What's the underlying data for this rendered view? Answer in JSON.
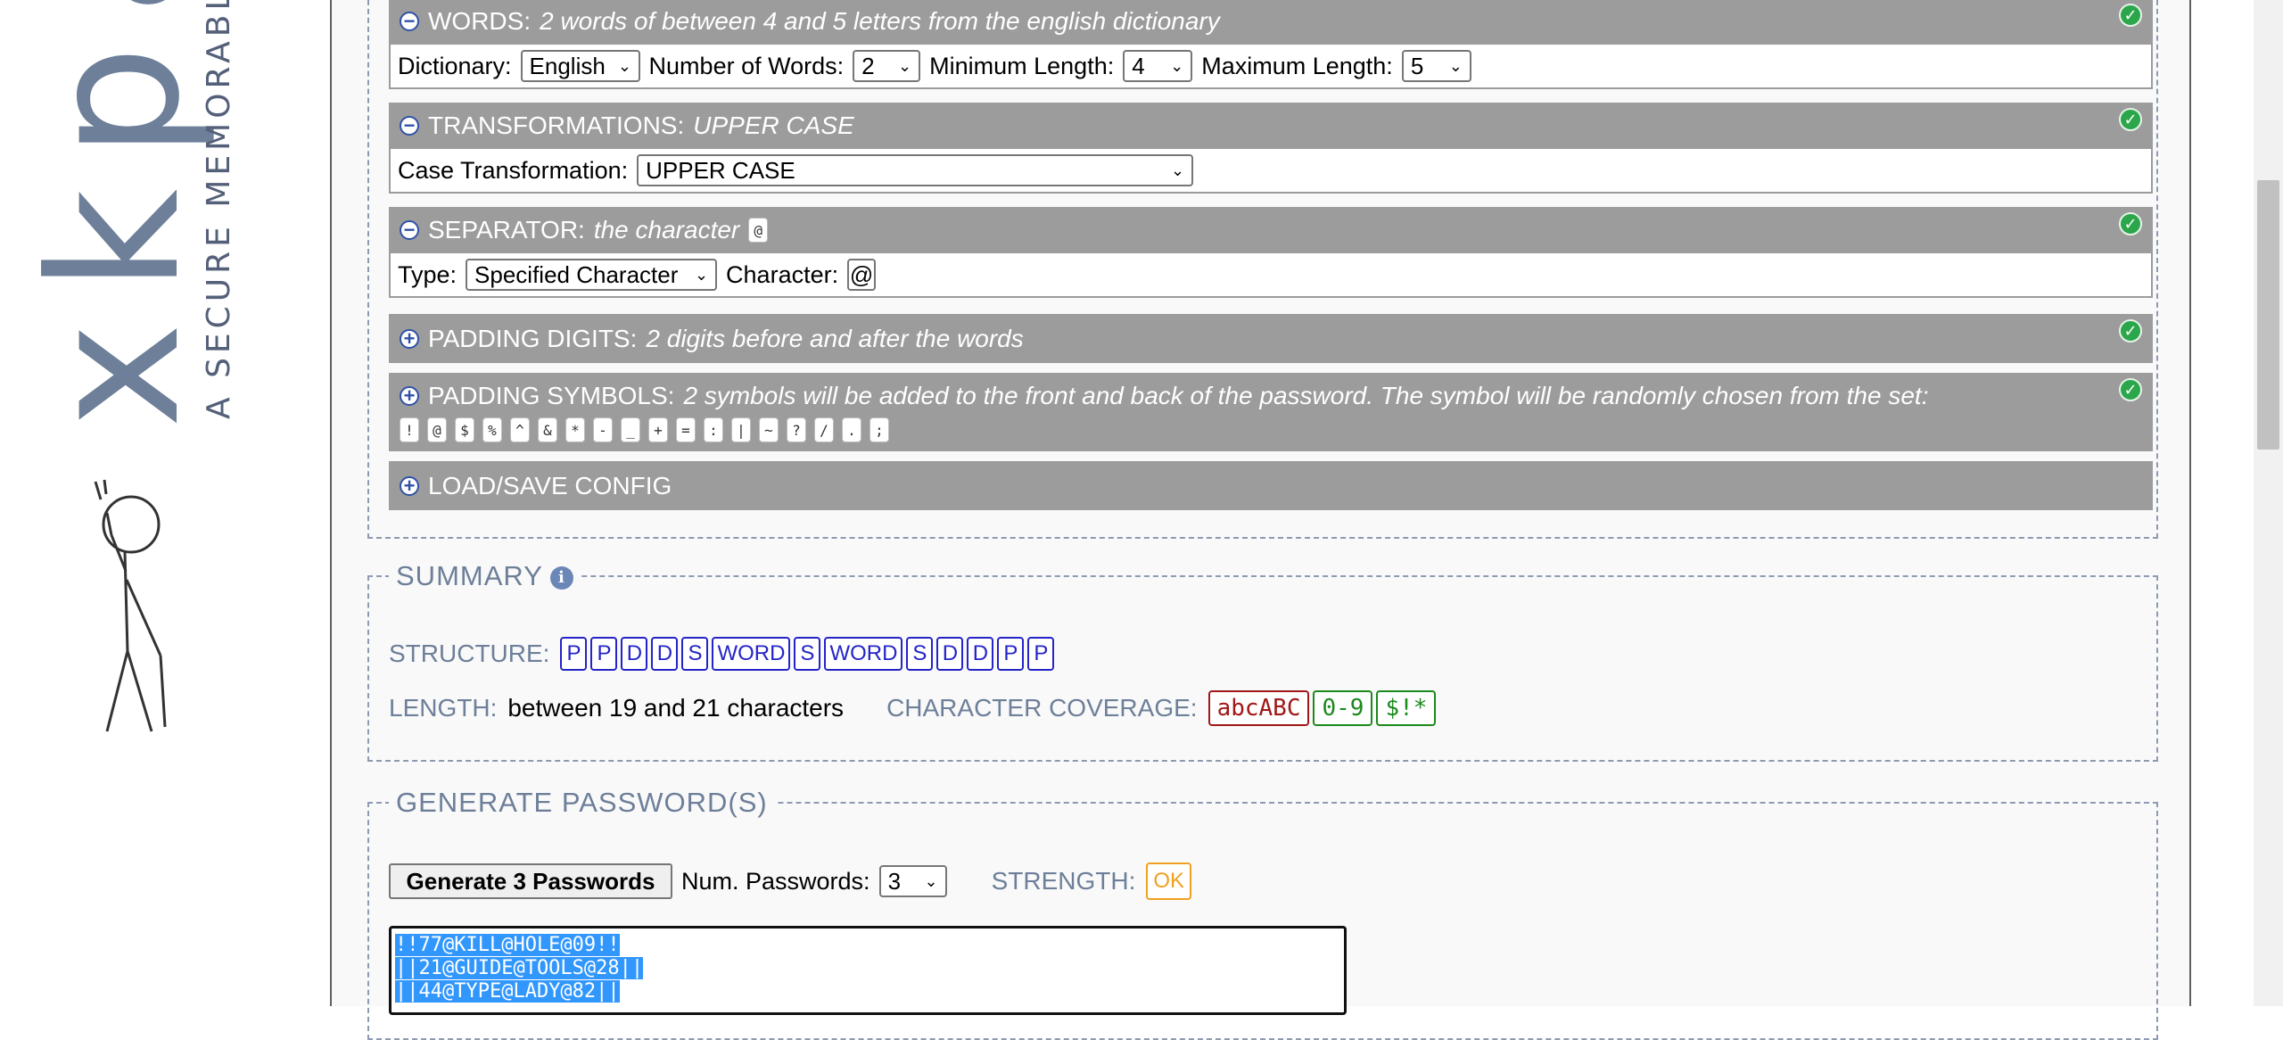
{
  "brand": {
    "logo_text": "xkpa",
    "tagline": "A SECURE MEMORABL"
  },
  "sections": {
    "words": {
      "title": "WORDS:",
      "summary": "2 words of between 4 and 5 letters from the english dictionary",
      "dictionary_label": "Dictionary:",
      "dictionary_value": "English",
      "num_words_label": "Number of Words:",
      "num_words_value": "2",
      "min_len_label": "Minimum Length:",
      "min_len_value": "4",
      "max_len_label": "Maximum Length:",
      "max_len_value": "5"
    },
    "transformations": {
      "title": "TRANSFORMATIONS:",
      "summary": "UPPER CASE",
      "case_label": "Case Transformation:",
      "case_value": "UPPER CASE"
    },
    "separator": {
      "title": "SEPARATOR:",
      "summary": "the character",
      "summary_char": "@",
      "type_label": "Type:",
      "type_value": "Specified Character",
      "char_label": "Character:",
      "char_value": "@"
    },
    "padding_digits": {
      "title": "PADDING DIGITS:",
      "summary": "2 digits before and after the words"
    },
    "padding_symbols": {
      "title": "PADDING SYMBOLS:",
      "summary": "2 symbols will be added to the front and back of the password. The symbol will be randomly chosen from the set:",
      "symbols": [
        "!",
        "@",
        "$",
        "%",
        "^",
        "&",
        "*",
        "-",
        "_",
        "+",
        "=",
        ":",
        "|",
        "~",
        "?",
        "/",
        ".",
        ";"
      ]
    },
    "load_save": {
      "title": "LOAD/SAVE CONFIG"
    }
  },
  "summary": {
    "legend": "SUMMARY",
    "structure_label": "STRUCTURE:",
    "structure": [
      "P",
      "P",
      "D",
      "D",
      "S",
      "WORD",
      "S",
      "WORD",
      "S",
      "D",
      "D",
      "P",
      "P"
    ],
    "length_label": "LENGTH:",
    "length_value": "between 19 and 21 characters",
    "coverage_label": "CHARACTER COVERAGE:",
    "coverage": [
      {
        "text": "abcABC",
        "color": "#a01818"
      },
      {
        "text": "0-9",
        "color": "#1a8a1a"
      },
      {
        "text": "$!*",
        "color": "#1a8a1a"
      }
    ]
  },
  "generate": {
    "legend": "GENERATE PASSWORD(S)",
    "button_label": "Generate 3 Passwords",
    "num_label": "Num. Passwords:",
    "num_value": "3",
    "strength_label": "STRENGTH:",
    "strength_value": "OK",
    "strength_color": "#f0a020",
    "passwords": [
      "!!77@KILL@HOLE@09!!",
      "||21@GUIDE@TOOLS@28||",
      "||44@TYPE@LADY@82||"
    ]
  },
  "colors": {
    "section_header": "#9c9c9c",
    "legend_text": "#6d7f99",
    "structure_token": "#2424c8",
    "selection": "#3297fd"
  }
}
